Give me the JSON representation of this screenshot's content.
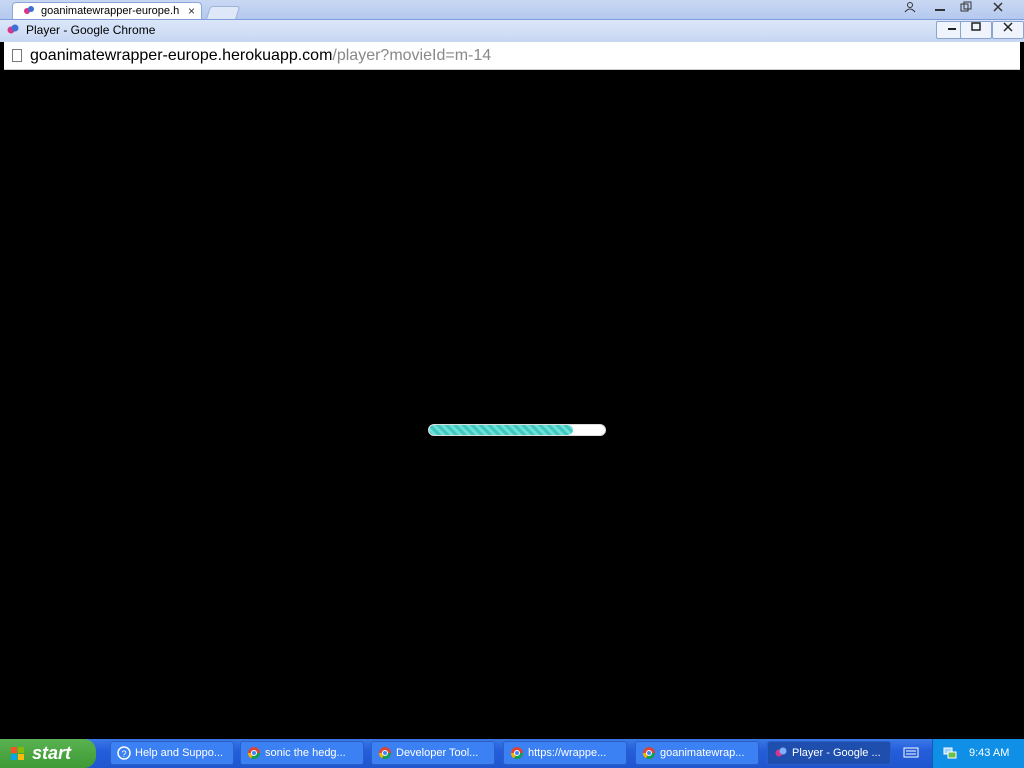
{
  "tabstrip": {
    "active_tab_title": "goanimatewrapper-europe.h",
    "close_glyph": "×"
  },
  "window": {
    "title": "Player - Google Chrome"
  },
  "address_bar": {
    "host": "goanimatewrapper-europe.herokuapp.com",
    "path": "/player?movieId=m-14"
  },
  "player": {
    "loading_progress_percent": 82,
    "progress_color": "#3fc9c0"
  },
  "taskbar": {
    "start_label": "start",
    "tasks": [
      {
        "label": "Help and Suppo...",
        "icon": "help-icon"
      },
      {
        "label": "sonic the hedg...",
        "icon": "chrome-icon"
      },
      {
        "label": "Developer Tool...",
        "icon": "chrome-icon"
      },
      {
        "label": "https://wrappe...",
        "icon": "chrome-icon"
      },
      {
        "label": "goanimatewrap...",
        "icon": "chrome-icon"
      },
      {
        "label": "Player - Google ...",
        "icon": "wrapper-icon"
      }
    ],
    "clock": "9:43 AM"
  }
}
